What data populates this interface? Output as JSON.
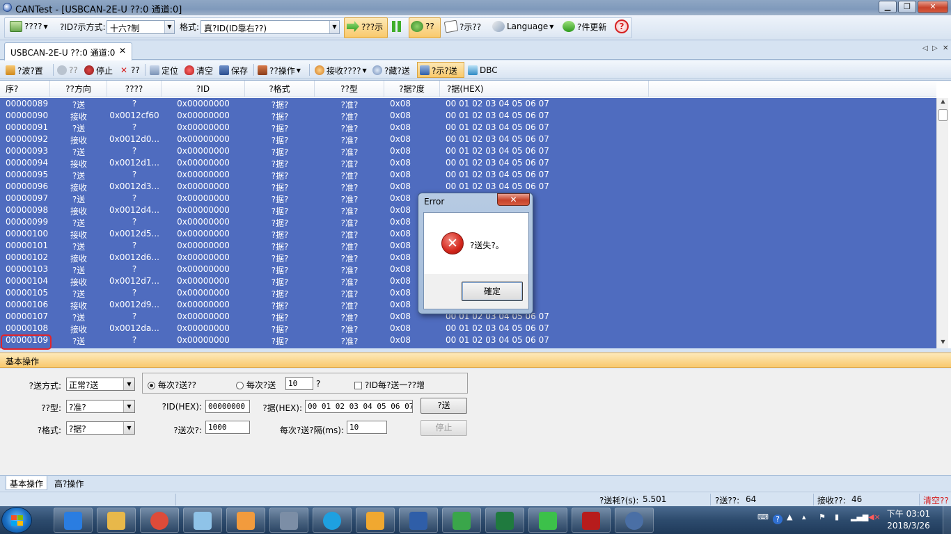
{
  "window": {
    "title": "CANTest - [USBCAN-2E-U ??:0 通道:0]",
    "buttons": {
      "minimize": "▁",
      "maximize": "❐",
      "close": "✕"
    }
  },
  "toolbar1": {
    "device_menu": "????",
    "id_format_label": "?ID?示方式:",
    "id_format_value": "十六?制",
    "format_label": "格式:",
    "format_value": "真?ID(ID靠右??)",
    "realtime_label": "???示",
    "pause_icon": "pause-icon",
    "filter_label": "??",
    "display_label": "?示??",
    "language_label": "Language",
    "update_label": "?件更新",
    "help_icon": "help-icon"
  },
  "tabstrip": {
    "tab_label": "USBCAN-2E-U ??:0 通道:0",
    "close": "✕",
    "nav_left": "◁",
    "nav_right": "▷",
    "nav_close": "✕"
  },
  "toolbar2": {
    "filter_setting": "?波?置",
    "start": "??",
    "stop": "停止",
    "reset": "??",
    "locate": "定位",
    "clear": "清空",
    "save": "保存",
    "device_ops": "??操作",
    "recv_time": "接收????",
    "hide_send": "?藏?送",
    "show_send": "?示?送",
    "dbc": "DBC"
  },
  "grid": {
    "columns": [
      "序?",
      "??方向",
      "????",
      "?ID",
      "?格式",
      "??型",
      "?据?度",
      "?据(HEX)"
    ],
    "rows": [
      [
        "00000089",
        "?送",
        "?",
        "0x00000000",
        "?据?",
        "?准?",
        "0x08",
        "00 01 02 03 04 05 06 07"
      ],
      [
        "00000090",
        "接收",
        "0x0012cf60",
        "0x00000000",
        "?据?",
        "?准?",
        "0x08",
        "00 01 02 03 04 05 06 07"
      ],
      [
        "00000091",
        "?送",
        "?",
        "0x00000000",
        "?据?",
        "?准?",
        "0x08",
        "00 01 02 03 04 05 06 07"
      ],
      [
        "00000092",
        "接收",
        "0x0012d0...",
        "0x00000000",
        "?据?",
        "?准?",
        "0x08",
        "00 01 02 03 04 05 06 07"
      ],
      [
        "00000093",
        "?送",
        "?",
        "0x00000000",
        "?据?",
        "?准?",
        "0x08",
        "00 01 02 03 04 05 06 07"
      ],
      [
        "00000094",
        "接收",
        "0x0012d1...",
        "0x00000000",
        "?据?",
        "?准?",
        "0x08",
        "00 01 02 03 04 05 06 07"
      ],
      [
        "00000095",
        "?送",
        "?",
        "0x00000000",
        "?据?",
        "?准?",
        "0x08",
        "00 01 02 03 04 05 06 07"
      ],
      [
        "00000096",
        "接收",
        "0x0012d3...",
        "0x00000000",
        "?据?",
        "?准?",
        "0x08",
        "00 01 02 03 04 05 06 07"
      ],
      [
        "00000097",
        "?送",
        "?",
        "0x00000000",
        "?据?",
        "?准?",
        "0x08",
        ""
      ],
      [
        "00000098",
        "接收",
        "0x0012d4...",
        "0x00000000",
        "?据?",
        "?准?",
        "0x08",
        ""
      ],
      [
        "00000099",
        "?送",
        "?",
        "0x00000000",
        "?据?",
        "?准?",
        "0x08",
        ""
      ],
      [
        "00000100",
        "接收",
        "0x0012d5...",
        "0x00000000",
        "?据?",
        "?准?",
        "0x08",
        ""
      ],
      [
        "00000101",
        "?送",
        "?",
        "0x00000000",
        "?据?",
        "?准?",
        "0x08",
        ""
      ],
      [
        "00000102",
        "接收",
        "0x0012d6...",
        "0x00000000",
        "?据?",
        "?准?",
        "0x08",
        ""
      ],
      [
        "00000103",
        "?送",
        "?",
        "0x00000000",
        "?据?",
        "?准?",
        "0x08",
        ""
      ],
      [
        "00000104",
        "接收",
        "0x0012d7...",
        "0x00000000",
        "?据?",
        "?准?",
        "0x08",
        ""
      ],
      [
        "00000105",
        "?送",
        "?",
        "0x00000000",
        "?据?",
        "?准?",
        "0x08",
        ""
      ],
      [
        "00000106",
        "接收",
        "0x0012d9...",
        "0x00000000",
        "?据?",
        "?准?",
        "0x08",
        ""
      ],
      [
        "00000107",
        "?送",
        "?",
        "0x00000000",
        "?据?",
        "?准?",
        "0x08",
        "00 01 02 03 04 05 06 07"
      ],
      [
        "00000108",
        "接收",
        "0x0012da...",
        "0x00000000",
        "?据?",
        "?准?",
        "0x08",
        "00 01 02 03 04 05 06 07"
      ],
      [
        "00000109",
        "?送",
        "?",
        "0x00000000",
        "?据?",
        "?准?",
        "0x08",
        "00 01 02 03 04 05 06 07"
      ]
    ]
  },
  "panel": {
    "header": "基本操作",
    "send_mode_label": "?送方式:",
    "send_mode_value": "正常?送",
    "radio_each_send": "每次?送??",
    "radio_each_send2": "每次?送",
    "each_send_count": "10",
    "each_send_unit": "?",
    "checkbox_id_increment": "?ID每?送一??增",
    "frame_type_label": "??型:",
    "frame_type_value": "?准?",
    "frame_id_label": "?ID(HEX):",
    "frame_id_value": "00000000",
    "data_label": "?据(HEX):",
    "data_value": "00 01 02 03 04 05 06 07",
    "send_button": "?送",
    "frame_format_label": "?格式:",
    "frame_format_value": "?据?",
    "send_count_label": "?送次?:",
    "send_count_value": "1000",
    "interval_label": "每次?送?隔(ms):",
    "interval_value": "10",
    "stop_button": "停止"
  },
  "bottom_tabs": [
    "基本操作",
    "高?操作"
  ],
  "status": {
    "elapsed_label": "?送耗?(s):",
    "elapsed_value": "5.501",
    "sent_label": "?送??:",
    "sent_value": "64",
    "recv_label": "接收??:",
    "recv_value": "46",
    "clear_label": "清空??"
  },
  "dialog": {
    "title": "Error",
    "close": "✕",
    "message": "?送失?。",
    "ok": "確定"
  },
  "taskbar": {
    "clock_time": "下午 03:01",
    "clock_date": "2018/3/26",
    "tray_icons": [
      "keyboard-icon",
      "help-icon",
      "arrow-up-icon",
      "flag-icon",
      "power-icon",
      "signal-icon",
      "volume-icon"
    ],
    "apps": [
      "internet-explorer-icon",
      "file-explorer-icon",
      "chrome-icon",
      "notes-icon",
      "media-player-icon",
      "calculator-icon",
      "skype-icon",
      "outlook-icon",
      "board-app-icon",
      "analyzer-app-icon",
      "excel-icon",
      "line-icon",
      "acrobat-icon",
      "can-app-icon"
    ]
  }
}
